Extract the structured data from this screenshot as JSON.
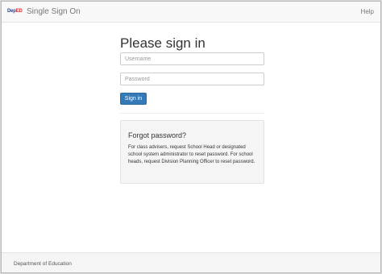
{
  "navbar": {
    "logo_part1": "DepEd",
    "brand": "Single Sign On",
    "help": "Help"
  },
  "login": {
    "heading": "Please sign in",
    "username_placeholder": "Username",
    "password_placeholder": "Password",
    "signin_label": "Sign in"
  },
  "forgot": {
    "title": "Forgot password?",
    "text": "For class advisers, request School Head or designated school system administrator to reset password. For school heads, request Division Planning Officer to reset password."
  },
  "footer": {
    "text": "Department of Education"
  },
  "colors": {
    "primary": "#337ab7",
    "navbar_bg": "#f8f8f8",
    "well_bg": "#f5f5f5"
  }
}
